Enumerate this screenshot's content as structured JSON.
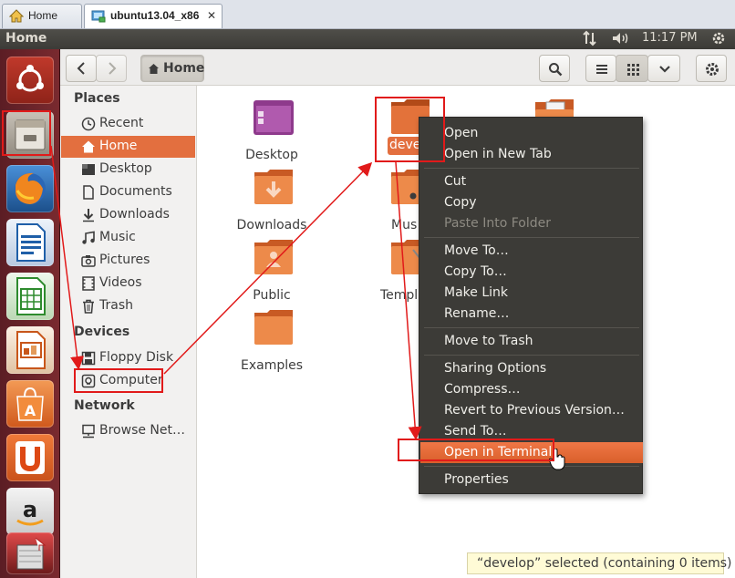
{
  "host_tabs": [
    {
      "label": "Home",
      "icon": "home-icon",
      "active": false
    },
    {
      "label": "ubuntu13.04_x86",
      "icon": "vm-icon",
      "active": true,
      "close": "✕"
    }
  ],
  "top_panel": {
    "title": "Home",
    "time": "11:17 PM",
    "tray_icons": [
      "network-icon",
      "volume-icon",
      "gear-icon"
    ]
  },
  "launcher": {
    "items": [
      "ubuntu-dash-icon",
      "files-icon",
      "firefox-icon",
      "writer-icon",
      "calc-icon",
      "impress-icon",
      "software-center-icon",
      "ubuntu-one-icon",
      "amazon-icon",
      "updates-icon"
    ]
  },
  "toolbar": {
    "back": "back-icon",
    "forward": "forward-icon",
    "location": "Home",
    "search": "search-icon",
    "list_view": "list-view-icon",
    "grid_view": "grid-view-icon",
    "view_menu": "chevron-down-icon",
    "settings": "gear-icon"
  },
  "sidebar": {
    "places_heading": "Places",
    "places": [
      {
        "label": "Recent",
        "icon": "clock-icon"
      },
      {
        "label": "Home",
        "icon": "home-icon",
        "selected": true
      },
      {
        "label": "Desktop",
        "icon": "desktop-icon"
      },
      {
        "label": "Documents",
        "icon": "document-icon"
      },
      {
        "label": "Downloads",
        "icon": "download-icon"
      },
      {
        "label": "Music",
        "icon": "music-icon"
      },
      {
        "label": "Pictures",
        "icon": "camera-icon"
      },
      {
        "label": "Videos",
        "icon": "film-icon"
      },
      {
        "label": "Trash",
        "icon": "trash-icon"
      }
    ],
    "devices_heading": "Devices",
    "devices": [
      {
        "label": "Floppy Disk",
        "icon": "floppy-icon"
      },
      {
        "label": "Computer",
        "icon": "computer-icon"
      }
    ],
    "network_heading": "Network",
    "network": [
      {
        "label": "Browse Net…",
        "icon": "network-icon"
      }
    ]
  },
  "files": [
    {
      "label": "Desktop",
      "icon": "desktop-folder-icon"
    },
    {
      "label": "Downloads",
      "icon": "downloads-folder-icon"
    },
    {
      "label": "Public",
      "icon": "public-folder-icon"
    },
    {
      "label": "Examples",
      "icon": "examples-folder-icon"
    },
    {
      "label": "develop",
      "icon": "folder-icon",
      "selected": true
    },
    {
      "label": "Mus",
      "icon": "music-folder-icon"
    },
    {
      "label": "Templ",
      "icon": "templates-folder-icon"
    },
    {
      "label": "",
      "icon": "documents-folder-icon"
    }
  ],
  "context_menu": {
    "groups": [
      [
        {
          "label": "Open"
        },
        {
          "label": "Open in New Tab"
        }
      ],
      [
        {
          "label": "Cut"
        },
        {
          "label": "Copy"
        },
        {
          "label": "Paste Into Folder",
          "disabled": true
        }
      ],
      [
        {
          "label": "Move To…"
        },
        {
          "label": "Copy To…"
        },
        {
          "label": "Make Link"
        },
        {
          "label": "Rename…"
        }
      ],
      [
        {
          "label": "Move to Trash"
        }
      ],
      [
        {
          "label": "Sharing Options"
        },
        {
          "label": "Compress…"
        },
        {
          "label": "Revert to Previous Version…"
        },
        {
          "label": "Send To…"
        },
        {
          "label": "Open in Terminal",
          "highlight": true
        }
      ],
      [
        {
          "label": "Properties"
        }
      ]
    ]
  },
  "status_bar": {
    "text": "“develop” selected  (containing 0 items)"
  },
  "colors": {
    "accent": "#e36f3f",
    "menu_bg": "#3c3b37",
    "annotation": "#e11a1a",
    "launcher": "#6b2329"
  }
}
